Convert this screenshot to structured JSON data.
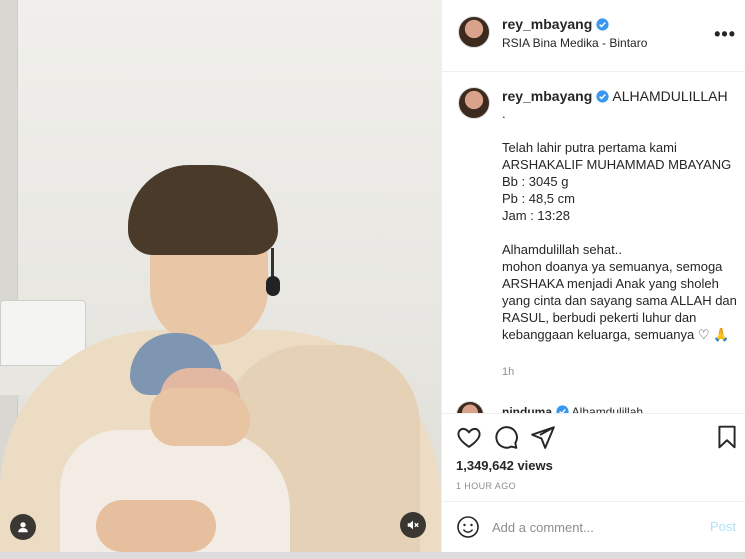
{
  "post": {
    "username": "rey_mbayang",
    "location": "RSIA Bina Medika - Bintaro",
    "more_label": "•••"
  },
  "caption": {
    "username": "rey_mbayang",
    "first_line": "ALHAMDULILLAH",
    "lines": ".\n\nTelah lahir putra pertama kami\nARSHAKALIF MUHAMMAD MBAYANG\nBb : 3045 g\nPb : 48,5 cm\nJam : 13:28\n\nAlhamdulillah sehat..\nmohon doanya ya semuanya, semoga ARSHAKA menjadi Anak yang sholeh yang cinta dan sayang sama ALLAH dan RASUL, berbudi pekerti luhur dan kebanggaan keluarga, semuanya ♡ 🙏",
    "time": "1h"
  },
  "reply": {
    "username": "ninduma",
    "text": "Alhamdulillah"
  },
  "stats": {
    "views": "1,349,642 views",
    "posted": "1 HOUR AGO"
  },
  "comment_box": {
    "placeholder": "Add a comment...",
    "post_label": "Post"
  },
  "icons": {
    "user_tag": "user-icon",
    "mute": "muted-speaker-icon",
    "like": "heart-icon",
    "comment": "comment-icon",
    "share": "send-icon",
    "save": "bookmark-icon",
    "emoji": "smiley-icon",
    "verified": "verified-badge-icon"
  },
  "colors": {
    "verified": "#3897f0",
    "post_disabled": "#b2dffc",
    "muted_text": "#8e8e8e"
  }
}
